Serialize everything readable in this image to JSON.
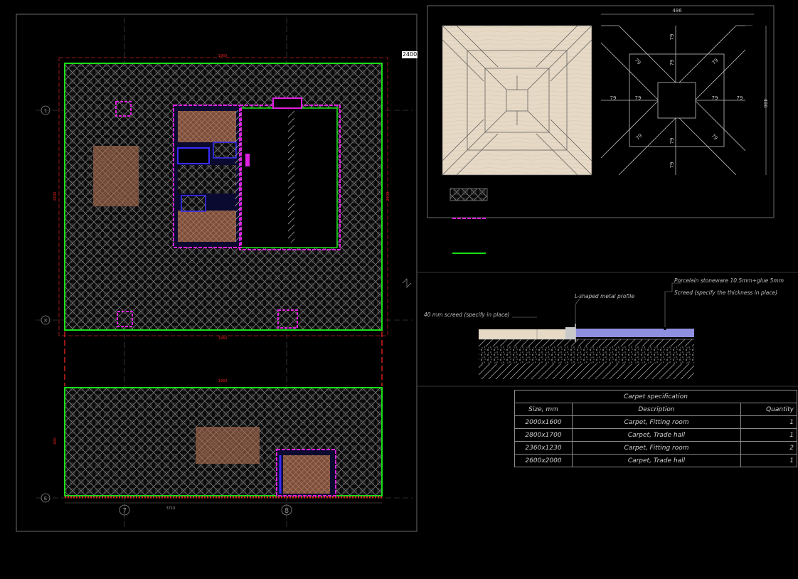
{
  "plan": {
    "scale_tag": "2400",
    "dim_top": "1960",
    "dim_mid": "1960",
    "dim_lower": "1960",
    "dim_side": "2400",
    "dim_lower_side": "600",
    "dim_bottom": "3710",
    "axis_1": "1",
    "axis_x": "X",
    "axis_e": "E",
    "axis_7": "7",
    "axis_8": "8"
  },
  "tile_detail": {
    "overall": "486",
    "side": "486",
    "arm": "79"
  },
  "section": {
    "note_porcelain": "Porcelain stoneware 10.5mm+glue 5mm",
    "note_screed": "Screed (specify the thickness in place)",
    "note_profile": "L-shaped metal profile",
    "note_screed40": "40 mm screed (specify in place)"
  },
  "legend": {
    "magenta_color": "#e020e0",
    "green_color": "#20e020"
  },
  "colors": {
    "green": "#18e018",
    "magenta": "#e020e0",
    "blue": "#3a2cff",
    "carpet": "#8a5a45",
    "wood": "#e8dccb",
    "section_blue": "#8f8fe0"
  },
  "spec_table": {
    "caption": "Carpet specification",
    "headers": [
      "Size, mm",
      "Description",
      "Quantity"
    ],
    "rows": [
      {
        "size": "2000x1600",
        "desc": "Carpet, Fitting room",
        "qty": "1"
      },
      {
        "size": "2800x1700",
        "desc": "Carpet, Trade hall",
        "qty": "1"
      },
      {
        "size": "2360x1230",
        "desc": "Carpet, Fitting room",
        "qty": "2"
      },
      {
        "size": "2600x2000",
        "desc": "Carpet, Trade hall",
        "qty": "1"
      }
    ]
  }
}
